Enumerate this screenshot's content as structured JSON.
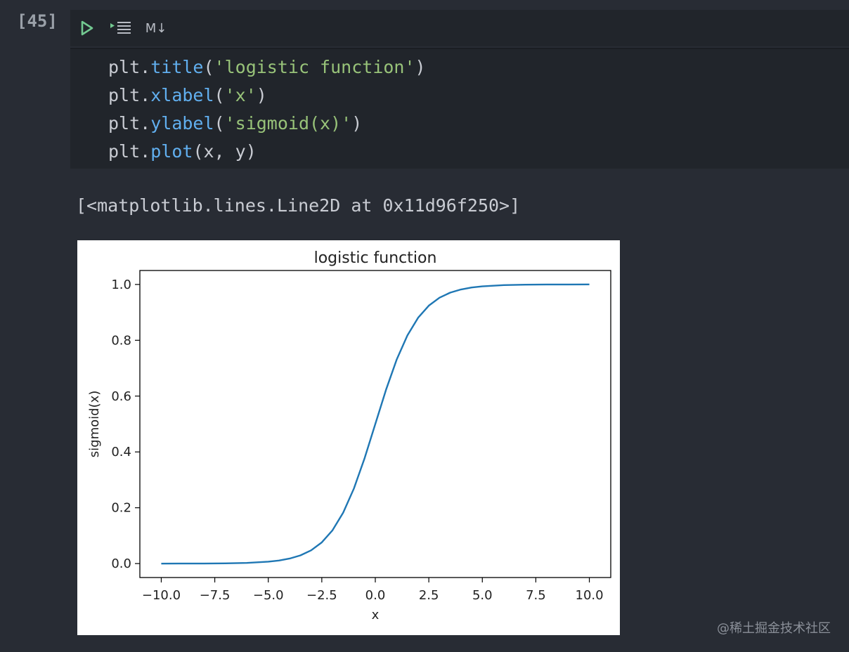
{
  "cell": {
    "execution_count": "[45]"
  },
  "toolbar": {
    "run_icon": "play-icon",
    "run_below_icon": "run-below-icon",
    "markdown_label": "M↓"
  },
  "code": {
    "lines": [
      [
        {
          "t": "plt.",
          "c": "plain"
        },
        {
          "t": "title",
          "c": "fn"
        },
        {
          "t": "(",
          "c": "plain"
        },
        {
          "t": "'logistic function'",
          "c": "str"
        },
        {
          "t": ")",
          "c": "plain"
        }
      ],
      [
        {
          "t": "plt.",
          "c": "plain"
        },
        {
          "t": "xlabel",
          "c": "fn"
        },
        {
          "t": "(",
          "c": "plain"
        },
        {
          "t": "'x'",
          "c": "str"
        },
        {
          "t": ")",
          "c": "plain"
        }
      ],
      [
        {
          "t": "plt.",
          "c": "plain"
        },
        {
          "t": "ylabel",
          "c": "fn"
        },
        {
          "t": "(",
          "c": "plain"
        },
        {
          "t": "'sigmoid(x)'",
          "c": "str"
        },
        {
          "t": ")",
          "c": "plain"
        }
      ],
      [
        {
          "t": "plt.",
          "c": "plain"
        },
        {
          "t": "plot",
          "c": "fn"
        },
        {
          "t": "(x, y)",
          "c": "plain"
        }
      ]
    ]
  },
  "output": {
    "text": "[<matplotlib.lines.Line2D at 0x11d96f250>]"
  },
  "chart_data": {
    "type": "line",
    "title": "logistic function",
    "xlabel": "x",
    "ylabel": "sigmoid(x)",
    "xlim": [
      -11,
      11
    ],
    "ylim": [
      -0.05,
      1.05
    ],
    "xticks": [
      -10.0,
      -7.5,
      -5.0,
      -2.5,
      0.0,
      2.5,
      5.0,
      7.5,
      10.0
    ],
    "xtick_labels": [
      "−10.0",
      "−7.5",
      "−5.0",
      "−2.5",
      "0.0",
      "2.5",
      "5.0",
      "7.5",
      "10.0"
    ],
    "yticks": [
      0.0,
      0.2,
      0.4,
      0.6,
      0.8,
      1.0
    ],
    "ytick_labels": [
      "0.0",
      "0.2",
      "0.4",
      "0.6",
      "0.8",
      "1.0"
    ],
    "grid": false,
    "series": [
      {
        "color": "#1f77b4",
        "x": [
          -10,
          -9,
          -8,
          -7,
          -6,
          -5,
          -4.5,
          -4,
          -3.5,
          -3,
          -2.5,
          -2,
          -1.5,
          -1,
          -0.5,
          0,
          0.5,
          1,
          1.5,
          2,
          2.5,
          3,
          3.5,
          4,
          4.5,
          5,
          6,
          7,
          8,
          9,
          10
        ],
        "y": [
          0.0,
          0.0001,
          0.0003,
          0.0009,
          0.0025,
          0.0067,
          0.011,
          0.018,
          0.0293,
          0.0474,
          0.0759,
          0.1192,
          0.1824,
          0.2689,
          0.3775,
          0.5,
          0.6225,
          0.7311,
          0.8176,
          0.8808,
          0.9241,
          0.9526,
          0.9707,
          0.982,
          0.989,
          0.9933,
          0.9975,
          0.9991,
          0.9997,
          0.9999,
          1.0
        ]
      }
    ]
  },
  "watermark": "@稀土掘金技术社区"
}
